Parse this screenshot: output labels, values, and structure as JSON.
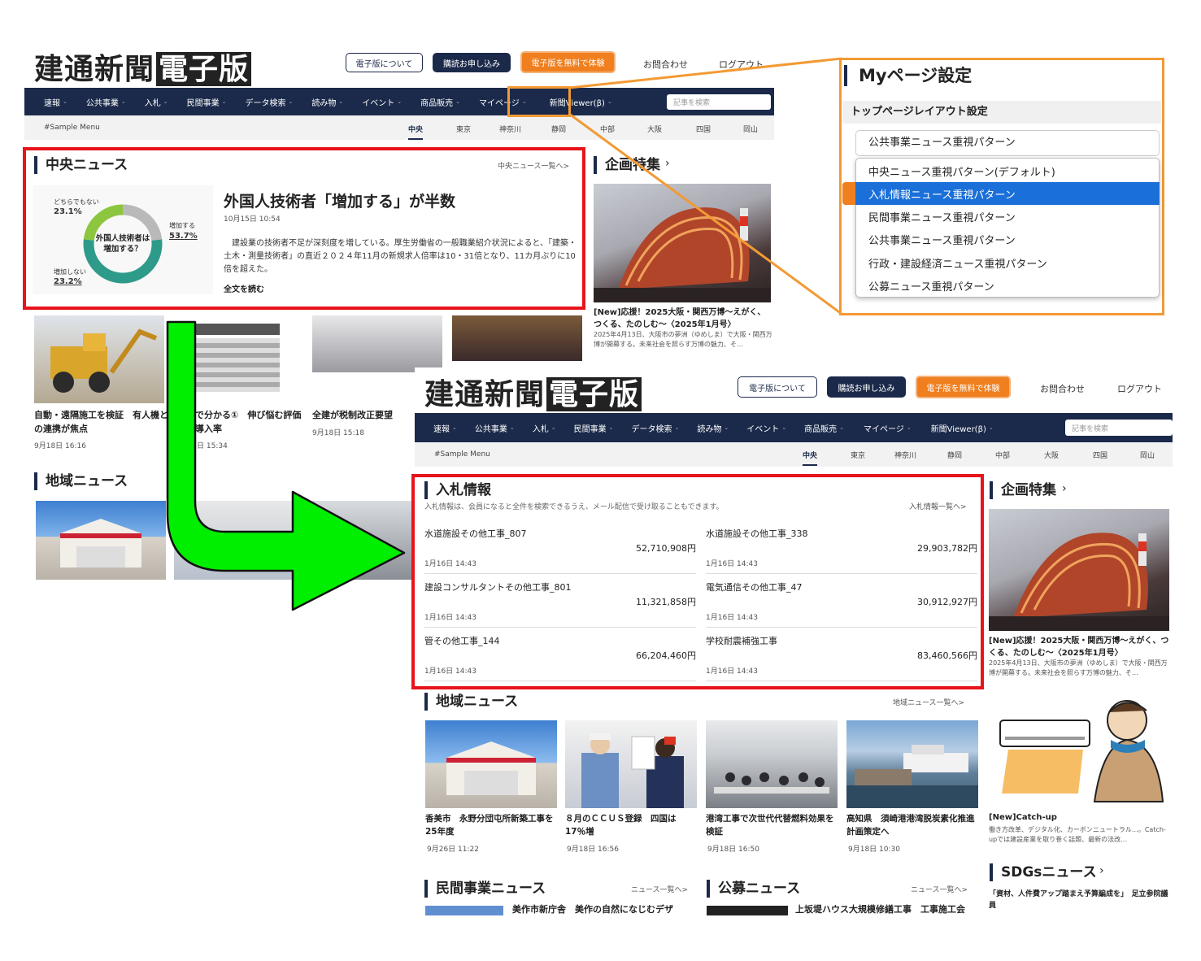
{
  "top": {
    "logo_main": "建通新聞",
    "logo_sub": "電子版",
    "btn_about": "電子版について",
    "btn_subscribe": "購読お申し込み",
    "btn_trial": "電子版を無料で体験",
    "link_contact": "お問合わせ",
    "link_logout": "ログアウト"
  },
  "nav": {
    "items": [
      "速報",
      "公共事業",
      "入札",
      "民間事業",
      "データ検索",
      "読み物",
      "イベント",
      "商品販売",
      "マイページ",
      "新聞Viewer(β)"
    ],
    "search_placeholder": "記事を検索"
  },
  "subnav": {
    "sample_menu": "#Sample Menu",
    "regions": [
      "中央",
      "東京",
      "神奈川",
      "静岡",
      "中部",
      "大阪",
      "四国",
      "岡山"
    ]
  },
  "before": {
    "central_title": "中央ニュース",
    "central_more": "中央ニュース一覧へ>",
    "article": {
      "headline": "外国人技術者「増加する」が半数",
      "date": "10月15日 10:54",
      "body": "建設業の技術者不足が深刻度を増している。厚生労働省の一般職業紹介状況によると、「建築・土木・測量技術者」の直近２０２４年11月の新規求人倍率は10・31倍となり、11カ月ぶりに10倍を超えた。",
      "read_more": "全文を読む"
    },
    "donut": {
      "center_label": "外国人技術者は増加する？",
      "segments": [
        {
          "label": "どちらでもない",
          "pct": "23.1%",
          "value": 23.1,
          "color": "#b9b9b9"
        },
        {
          "label": "増加する",
          "pct": "53.7%",
          "value": 53.7,
          "color": "#2e9a8a"
        },
        {
          "label": "増加しない",
          "pct": "23.2%",
          "value": 23.2,
          "color": "#8cc63f"
        }
      ]
    },
    "feature_title": "企画特集",
    "feature_caption": "[New]応援！2025大阪・関西万博～えがく、つくる、たのしむ～〈2025年1月号〉",
    "feature_desc": "2025年4月13日、大阪市の夢洲（ゆめしま）で大阪・関西万博が開幕する。未来社会を照らす万博の魅力、そ…",
    "cards": [
      {
        "caption": "自動・遠隔施工を検証　有人機との連携が焦点",
        "date": "9月18日 16:16"
      },
      {
        "caption": "で分かる①　伸び悩む評価導入率",
        "date": "日 15:34"
      },
      {
        "caption": "全建が税制改正要望",
        "date": "9月18日 15:18"
      }
    ],
    "region_title": "地域ニュース"
  },
  "mypage": {
    "title": "Myページ設定",
    "subtitle": "トップページレイアウト設定",
    "current": "公共事業ニュース重視パターン",
    "options": [
      "中央ニュース重視パターン(デフォルト)",
      "入札情報ニュース重視パターン",
      "民間事業ニュース重視パターン",
      "公共事業ニュース重視パターン",
      "行政・建設経済ニュース重視パターン",
      "公募ニュース重視パターン"
    ],
    "selected_index": 1
  },
  "after": {
    "bid_title": "入札情報",
    "bid_desc": "入札情報は、会員になると全件を検索できるうえ、メール配信で受け取ることもできます。",
    "bid_more": "入札情報一覧へ>",
    "bids": [
      {
        "name": "水道施設その他工事_807",
        "price": "52,710,908円",
        "date": "1月16日 14:43"
      },
      {
        "name": "水道施設その他工事_338",
        "price": "29,903,782円",
        "date": "1月16日 14:43"
      },
      {
        "name": "建設コンサルタントその他工事_801",
        "price": "11,321,858円",
        "date": "1月16日 14:43"
      },
      {
        "name": "電気通信その他工事_47",
        "price": "30,912,927円",
        "date": "1月16日 14:43"
      },
      {
        "name": "管その他工事_144",
        "price": "66,204,460円",
        "date": "1月16日 14:43"
      },
      {
        "name": "学校耐震補強工事",
        "price": "83,460,566円",
        "date": "1月16日 14:43"
      }
    ],
    "region_title": "地域ニュース",
    "region_more": "地域ニュース一覧へ>",
    "region_cards": [
      {
        "caption": "香美市　永野分団屯所新築工事を25年度",
        "date": "9月26日 11:22"
      },
      {
        "caption": "８月のＣＣＵＳ登録　四国は17％増",
        "date": "9月18日 16:56"
      },
      {
        "caption": "港湾工事で次世代代替燃料効果を検証",
        "date": "9月18日 16:50"
      },
      {
        "caption": "高知県　須崎港港湾脱炭素化推進計画策定へ",
        "date": "9月18日 10:30"
      }
    ],
    "feature_title": "企画特集",
    "feature_caption": "[New]応援！2025大阪・関西万博～えがく、つくる、たのしむ～〈2025年1月号〉",
    "feature_desc": "2025年4月13日、大阪市の夢洲（ゆめしま）で大阪・関西万博が開幕する。未来社会を照らす万博の魅力、そ…",
    "catchup_title": "[New]Catch-up",
    "catchup_desc": "働き方改革、デジタル化、カーボンニュートラル…。Catch-upでは建設産業を取り巻く話題、最新の法改…",
    "sdgs_title": "SDGsニュース",
    "sdgs_item": "「資材、人件費アップ踏まえ予算編成を」　足立参院議員",
    "private_title": "民間事業ニュース",
    "private_more": "ニュース一覧へ>",
    "private_item": "美作市新庁舎　美作の自然になじむデザ",
    "public_title": "公募ニュース",
    "public_more": "ニュース一覧へ>",
    "public_item": "上坂堤ハウス大規模修繕工事　工事施工会"
  },
  "colors": {
    "navy": "#1b2a4a",
    "orange": "#f07f1f",
    "red_frame": "#e8141b",
    "arrow_green": "#00ee00",
    "mypage_frame": "#f39a34",
    "select_blue": "#1a6fd8"
  }
}
